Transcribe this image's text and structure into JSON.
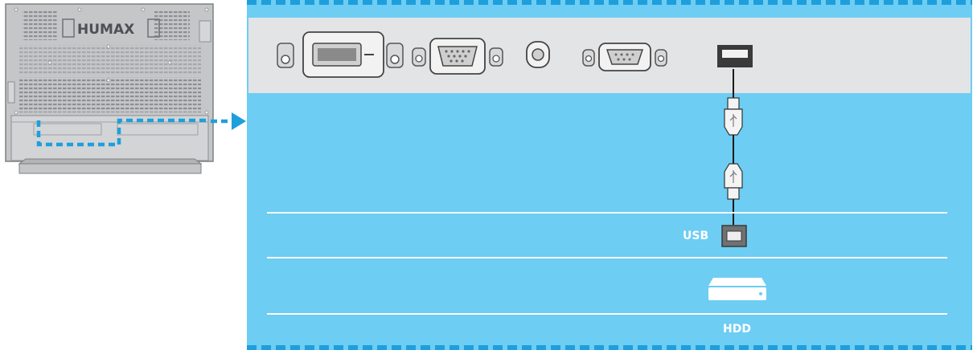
{
  "tv": {
    "brand": "HUMAX"
  },
  "labels": {
    "usb": "USB",
    "hdd": "HDD"
  },
  "colors": {
    "accent_blue": "#1e9fdc",
    "panel_blue": "#6dcdf3",
    "port_strip_gray": "#e3e4e5",
    "tv_gray": "#b9bcbf"
  },
  "icons": {
    "usb_cable": "usb-cable-icon",
    "usb_port": "usb-port-icon",
    "hdd": "hard-drive-icon",
    "arrow": "zoom-arrow-icon"
  }
}
